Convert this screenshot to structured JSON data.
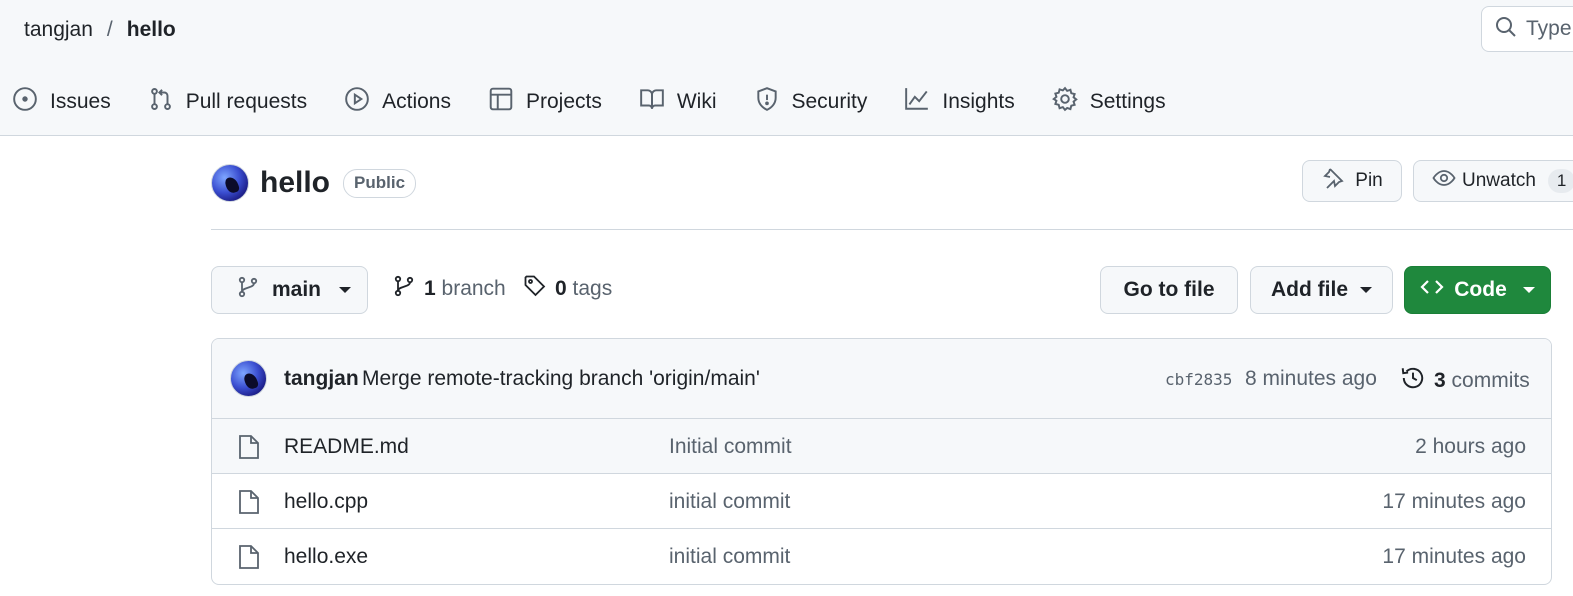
{
  "breadcrumb": {
    "owner": "tangjan",
    "separator": "/",
    "repo": "hello"
  },
  "search": {
    "placeholder": "Type"
  },
  "tabs": [
    {
      "label": "Issues",
      "icon": "issue-circle-icon"
    },
    {
      "label": "Pull requests",
      "icon": "pull-request-icon"
    },
    {
      "label": "Actions",
      "icon": "play-circle-icon"
    },
    {
      "label": "Projects",
      "icon": "table-icon"
    },
    {
      "label": "Wiki",
      "icon": "book-icon"
    },
    {
      "label": "Security",
      "icon": "shield-icon"
    },
    {
      "label": "Insights",
      "icon": "graph-icon"
    },
    {
      "label": "Settings",
      "icon": "gear-icon"
    }
  ],
  "repo": {
    "name": "hello",
    "visibility": "Public"
  },
  "actions": {
    "pin": "Pin",
    "unwatch": "Unwatch",
    "watch_count": "1"
  },
  "branch": {
    "current": "main",
    "branch_count": "1",
    "branch_label": "branch",
    "tag_count": "0",
    "tag_label": "tags"
  },
  "buttons": {
    "goto_file": "Go to file",
    "add_file": "Add file",
    "code": "Code"
  },
  "latest_commit": {
    "author": "tangjan",
    "message": "Merge remote-tracking branch 'origin/main'",
    "sha": "cbf2835",
    "time": "8 minutes ago",
    "count": "3",
    "count_label": "commits"
  },
  "files": [
    {
      "name": "README.md",
      "commit": "Initial commit",
      "time": "2 hours ago"
    },
    {
      "name": "hello.cpp",
      "commit": "initial commit",
      "time": "17 minutes ago"
    },
    {
      "name": "hello.exe",
      "commit": "initial commit",
      "time": "17 minutes ago"
    }
  ],
  "colors": {
    "header_bg": "#f6f8fa",
    "border": "#d0d7de",
    "code_button": "#1f883d",
    "muted_text": "#59636e"
  }
}
